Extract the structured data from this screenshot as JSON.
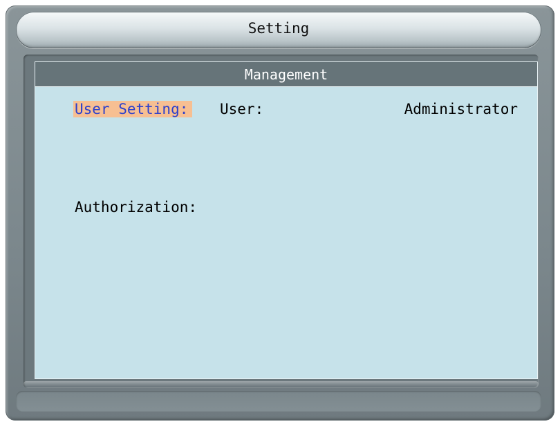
{
  "window": {
    "title": "Setting"
  },
  "section": {
    "title": "Management"
  },
  "fields": {
    "user_setting_label": "User Setting:",
    "user_label": "User:",
    "user_value": "Administrator",
    "authorization_label": "Authorization:"
  },
  "colors": {
    "highlight_bg": "#f7bf92",
    "highlight_text": "#2c40cc",
    "content_bg": "#c6e2ea",
    "header_bg": "#667479"
  }
}
